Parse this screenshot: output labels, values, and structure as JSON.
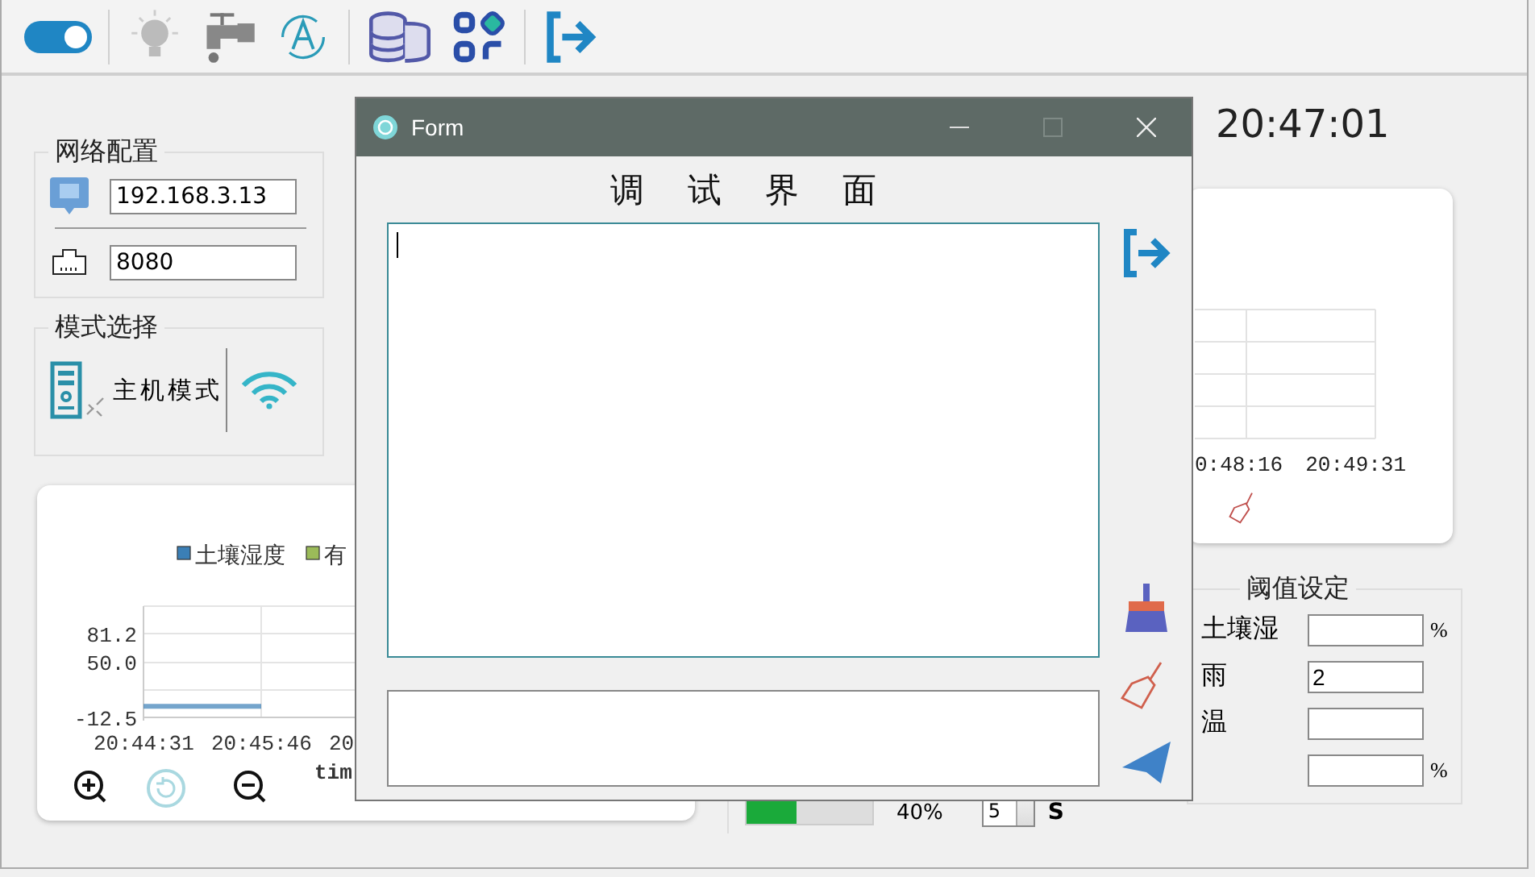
{
  "toolbar": {
    "toggle": {
      "on": true
    }
  },
  "network_config": {
    "title": "网络配置",
    "ip": "192.168.3.13",
    "port": "8080"
  },
  "mode_select": {
    "title": "模式选择",
    "mode": "主机模式"
  },
  "history_chart": {
    "chart_data": {
      "type": "line",
      "legend": "top",
      "grid": true,
      "ylim": [
        -12.5,
        112
      ],
      "xlabel": "tim",
      "categories": [
        "20:44:31",
        "20:45:46",
        "20"
      ],
      "yticks": [
        {
          "value": 81.2,
          "label": "81.2"
        },
        {
          "value": 50,
          "label": "50.0"
        },
        {
          "value": -12.5,
          "label": "-12.5"
        }
      ],
      "series": [
        {
          "name": "土壤湿度",
          "color": "#3b7fb6",
          "values": [
            0,
            0,
            null
          ]
        },
        {
          "name": "有",
          "color": "#9bbb59",
          "values": [
            null,
            null,
            null
          ]
        }
      ]
    }
  },
  "bottom_controls": {
    "progress": {
      "level": 0.4,
      "reading": "40%"
    },
    "interval": "5",
    "unit": "S"
  },
  "clock": "20:47:01",
  "realtime_chart": {
    "x_labels": [
      "0:48:16",
      "20:49:31"
    ]
  },
  "thresholds": {
    "title": "阈值设定",
    "rows": [
      {
        "label": "土壤湿",
        "unit": "%"
      },
      {
        "label": "雨",
        "value": "2"
      },
      {
        "label": "温"
      },
      {
        "unit": "%"
      }
    ]
  },
  "dialog": {
    "title": "Form",
    "heading": "调试界面"
  }
}
